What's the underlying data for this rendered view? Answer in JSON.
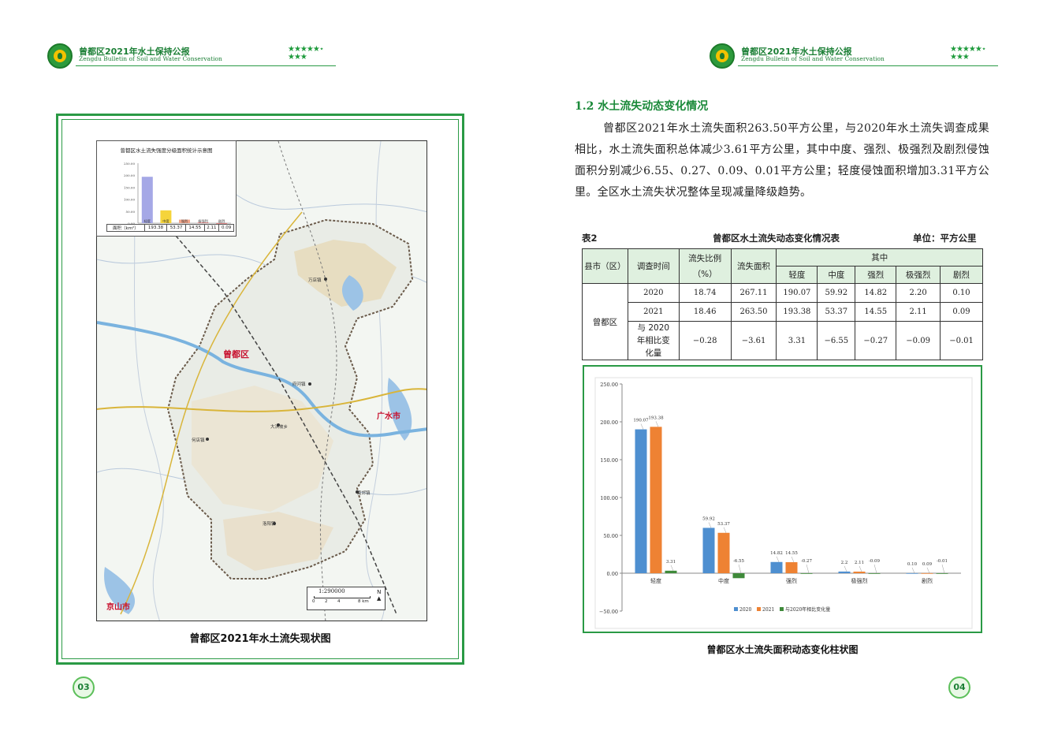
{
  "header": {
    "title": "曾都区2021年水土保持公报",
    "subtitle": "Zengdu Bulletin of Soil and Water Conservation"
  },
  "left_page": {
    "map_caption": "曾都区2021年水土流失现状图",
    "map_labels": {
      "district": "曾都区",
      "guangshui": "广水市",
      "jingshan": "京山市",
      "town1": "万店镇",
      "town2": "府河镇",
      "town3": "大洪坡乡",
      "town4": "何店镇",
      "town5": "南郊镇",
      "town6": "洛阳镇"
    },
    "scale_bar": {
      "ratio": "1:290000",
      "ticks": [
        "0",
        "2",
        "4",
        "8 km"
      ],
      "north": "N"
    },
    "inset": {
      "title": "曾都区水土流失强度分级面积统计示意图",
      "y_ticks": [
        "250.00",
        "200.00",
        "150.00",
        "100.00",
        "50.00",
        "0.00"
      ],
      "row_label": "面积（km²）",
      "categories": [
        "轻度",
        "中度",
        "强烈",
        "极强烈",
        "剧烈"
      ],
      "values_text": [
        "193.38",
        "53.37",
        "14.55",
        "2.11",
        "0.09"
      ]
    },
    "page_number": "03"
  },
  "right_page": {
    "section_title": "1.2 水土流失动态变化情况",
    "paragraph": "曾都区2021年水土流失面积263.50平方公里，与2020年水土流失调查成果相比，水土流失面积总体减少3.61平方公里，其中中度、强烈、极强烈及剧烈侵蚀面积分别减少6.55、0.27、0.09、0.01平方公里；轻度侵蚀面积增加3.31平方公里。全区水土流失状况整体呈现减量降级趋势。",
    "table_label": "表2",
    "table_title": "曾都区水土流失动态变化情况表",
    "table_unit": "单位：平方公里",
    "table": {
      "headers": {
        "county": "县市（区）",
        "time": "调查时间",
        "ratio": "流失比例（%）",
        "area": "流失面积",
        "among": "其中",
        "light": "轻度",
        "moderate": "中度",
        "intense": "强烈",
        "very_intense": "极强烈",
        "severe": "剧烈"
      },
      "county_name": "曾都区",
      "rows": [
        {
          "time": "2020",
          "cells": [
            "18.74",
            "267.11",
            "190.07",
            "59.92",
            "14.82",
            "2.20",
            "0.10"
          ]
        },
        {
          "time": "2021",
          "cells": [
            "18.46",
            "263.50",
            "193.38",
            "53.37",
            "14.55",
            "2.11",
            "0.09"
          ]
        },
        {
          "time": "与 2020 年相比变化量",
          "cells": [
            "−0.28",
            "−3.61",
            "3.31",
            "−6.55",
            "−0.27",
            "−0.09",
            "−0.01"
          ]
        }
      ]
    },
    "chart_caption": "曾都区水土流失面积动态变化柱状图",
    "page_number": "04"
  },
  "chart_data": {
    "type": "bar",
    "categories": [
      "轻度",
      "中度",
      "强烈",
      "极强烈",
      "剧烈"
    ],
    "series": [
      {
        "name": "2020",
        "values": [
          190.07,
          59.92,
          14.82,
          2.2,
          0.1
        ],
        "labels": [
          "190.07",
          "59.92",
          "14.82",
          "2.2",
          "0.10"
        ]
      },
      {
        "name": "2021",
        "values": [
          193.38,
          53.37,
          14.55,
          2.11,
          0.09
        ],
        "labels": [
          "193.38",
          "53.37",
          "14.55",
          "2.11",
          "0.09"
        ]
      },
      {
        "name": "与2020年相比变化量",
        "values": [
          3.31,
          -6.55,
          -0.27,
          -0.09,
          -0.01
        ],
        "labels": [
          "3.31",
          "-6.55",
          "-0.27",
          "-0.09",
          "-0.01"
        ]
      }
    ],
    "y_ticks": [
      "250.00",
      "200.00",
      "150.00",
      "100.00",
      "50.00",
      "0.00",
      "−50.00"
    ],
    "ylim": [
      -50,
      250
    ],
    "grid": false,
    "legend": "bottom",
    "colors": [
      "#4e8fd0",
      "#ee8233",
      "#3f8a3a"
    ]
  }
}
